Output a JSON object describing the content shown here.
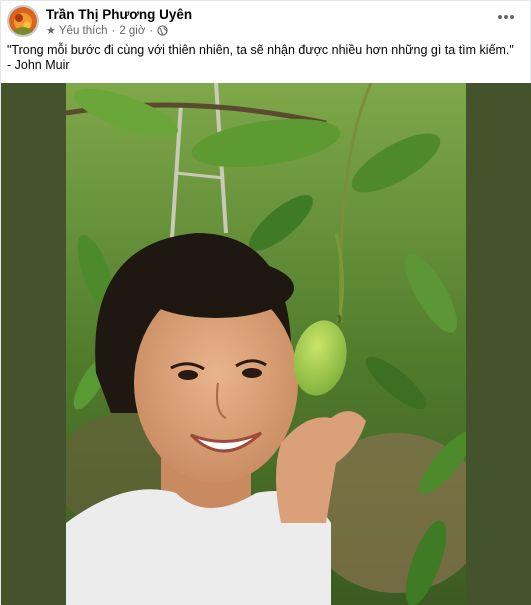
{
  "post": {
    "author": "Trần Thị Phương Uyên",
    "badge_label": "Yêu thích",
    "time": "2 giờ",
    "separator": "·",
    "caption_line1": "\"Trong mỗi bước đi cùng với thiên nhiên, ta sẽ nhận được nhiều hơn những gì ta tìm kiếm.\"",
    "caption_line2": "- John Muir",
    "icons": {
      "badge": "star-icon",
      "privacy": "globe-icon",
      "menu": "more-options-icon"
    }
  },
  "colors": {
    "photo_backdrop": "#43542d",
    "secondary_text": "#65676b",
    "primary_text": "#050505"
  }
}
